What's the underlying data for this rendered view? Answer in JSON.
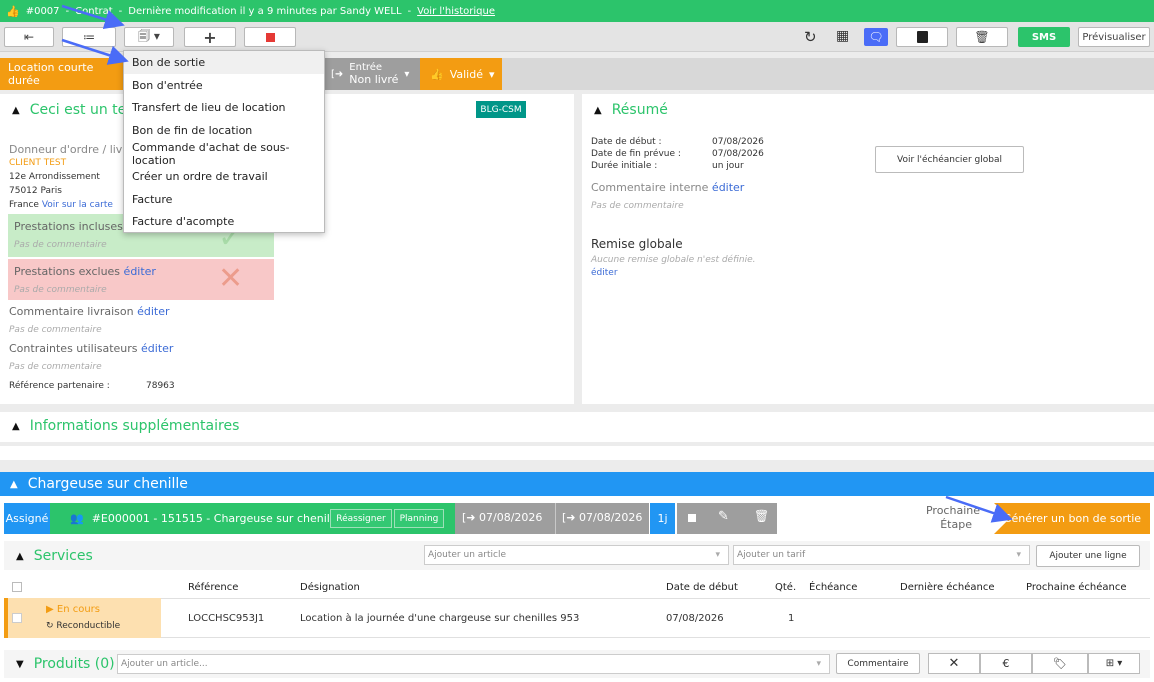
{
  "topbar": {
    "order_number": "#0007",
    "sep": "-",
    "doc_type": "Contrat",
    "modified_text": "Dernière modification il y a 9 minutes par Sandy WELL",
    "history_link": "Voir l'historique"
  },
  "toolbar": {
    "back_icon": "back-arrow-icon",
    "list_icon": "list-icon",
    "doc_icon": "document-icon",
    "add_icon": "plus-icon",
    "stop_icon": "stop-icon",
    "refresh_icon": "refresh-icon",
    "qr_icon": "qr-code-icon",
    "chat_icon": "chat-icon",
    "copy_icon": "copy-icon",
    "trash_icon": "trash-icon",
    "sms_label": "SMS",
    "preview_label": "Prévisualiser"
  },
  "dropdown": {
    "items": [
      "Bon de sortie",
      "Bon d'entrée",
      "Transfert de lieu de location",
      "Bon de fin de location",
      "Commande d'achat de sous-location",
      "Créer un ordre de travail",
      "Facture",
      "Facture d'acompte"
    ]
  },
  "status": {
    "rental_type": "Location courte durée",
    "entry_label": "Entrée",
    "entry_sub": "Non livré",
    "validated_label": "Validé"
  },
  "left_panel": {
    "title": "Ceci est un tes",
    "badge": "BLG-CSM",
    "donneur_label": "Donneur d'ordre / liv",
    "client": "CLIENT TEST",
    "address1": "12e Arrondissement",
    "address2": "75012 Paris",
    "country": "France",
    "map_link": "Voir sur la carte",
    "included_label": "Prestations incluses",
    "included_comment": "Pas de commentaire",
    "excluded_label": "Prestations exclues",
    "excluded_edit": "éditer",
    "excluded_comment": "Pas de commentaire",
    "delivery_label": "Commentaire livraison",
    "delivery_edit": "éditer",
    "delivery_comment": "Pas de commentaire",
    "constraints_label": "Contraintes utilisateurs",
    "constraints_edit": "éditer",
    "constraints_comment": "Pas de commentaire",
    "partner_ref_label": "Référence partenaire :",
    "partner_ref_value": "78963"
  },
  "summary": {
    "title": "Résumé",
    "start_label": "Date de début :",
    "start_value": "07/08/2026",
    "end_label": "Date de fin prévue :",
    "end_value": "07/08/2026",
    "duration_label": "Durée initiale :",
    "duration_value": "un jour",
    "schedule_button": "Voir l'échéancier global",
    "internal_label": "Commentaire interne",
    "internal_edit": "éditer",
    "internal_comment": "Pas de commentaire",
    "discount_title": "Remise globale",
    "discount_note": "Aucune remise globale n'est définie.",
    "discount_edit": "éditer"
  },
  "extra_info": {
    "title": "Informations supplémentaires"
  },
  "machine": {
    "title": "Chargeuse sur chenille",
    "assigned": "Assigné",
    "item_label": "#E000001 - 151515 - Chargeuse sur chenille...",
    "reassign": "Réassigner",
    "planning": "Planning",
    "date_out": "07/08/2026",
    "date_in": "07/08/2026",
    "duration": "1j",
    "next_step_1": "Prochaine",
    "next_step_2": "Étape",
    "generate_button": "Générer un bon de sortie"
  },
  "services": {
    "title": "Services",
    "article_placeholder": "Ajouter un article",
    "tariff_placeholder": "Ajouter un tarif",
    "add_line": "Ajouter une ligne",
    "columns": [
      "Référence",
      "Désignation",
      "Date de début",
      "Qté.",
      "Échéance",
      "Dernière échéance",
      "Prochaine échéance"
    ],
    "row": {
      "status": "En cours",
      "recurrence": "Reconductible",
      "reference": "LOCCHSC953J1",
      "designation": "Location à la journée d'une chargeuse sur chenilles 953",
      "start": "07/08/2026",
      "qty": "1"
    }
  },
  "products": {
    "title": "Produits (0)",
    "placeholder": "Ajouter un article...",
    "comment_button": "Commentaire"
  },
  "colors": {
    "green": "#2cc46b",
    "blue": "#2196f3",
    "orange": "#f39c12",
    "red": "#e53935",
    "teal": "#009688",
    "purple_blue": "#4a6cf7"
  }
}
